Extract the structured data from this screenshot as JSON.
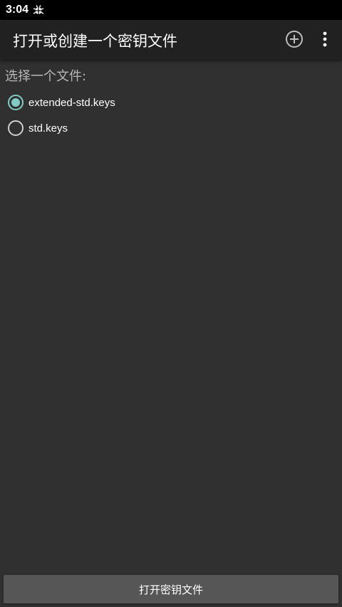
{
  "status_bar": {
    "time": "3:04",
    "notification_icon": "bug-icon"
  },
  "app_bar": {
    "title": "打开或创建一个密钥文件",
    "add_icon": "add-circle-icon",
    "overflow_icon": "more-vertical-icon"
  },
  "prompt": "选择一个文件:",
  "files": [
    {
      "label": "extended-std.keys",
      "checked": true
    },
    {
      "label": "std.keys",
      "checked": false
    }
  ],
  "open_button_label": "打开密钥文件",
  "colors": {
    "background": "#303030",
    "app_bar": "#212121",
    "accent": "#80cbc4",
    "button": "#565656"
  }
}
